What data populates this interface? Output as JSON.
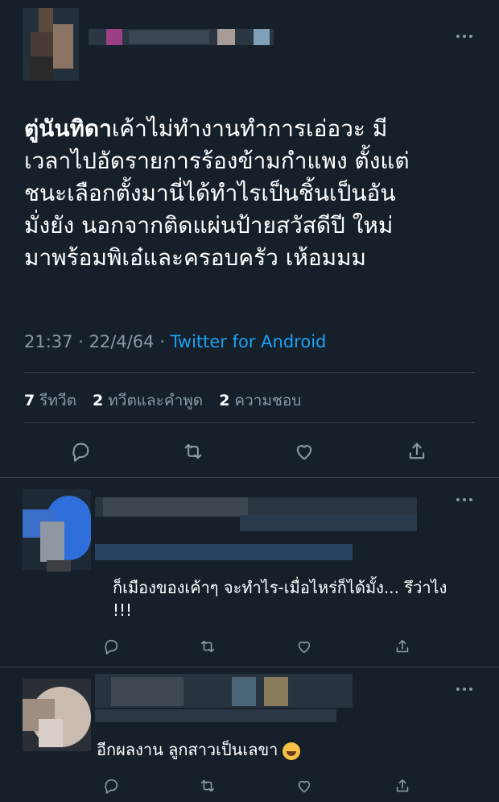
{
  "tweet": {
    "mention": "ตู่นันทิดา",
    "lines": [
      "เค้าไม่ทำงานทำการเอ่อวะ มี",
      "เวลาไปอัดรายการร้องข้ามกำแพง ตั้งแต่",
      "ชนะเลือกตั้งมานี่ได้ทำไรเป็นชิ้นเป็นอัน",
      "มั่งยัง นอกจากติดแผ่นป้ายสวัสดีปี ใหม่",
      "มาพร้อมพิเอ๋และครอบครัว เห้อมมม"
    ],
    "time": "21:37",
    "separator": " · ",
    "date": "22/4/64",
    "separator2": " · ",
    "source": "Twitter for Android",
    "stats": {
      "retweets": "7",
      "retweets_label": "รีทวีต",
      "quotes": "2",
      "quotes_label": "ทวีตและคำพูด",
      "likes": "2",
      "likes_label": "ความชอบ"
    }
  },
  "replies": [
    {
      "line1": "ก็เมืองของเค้าๆ จะทำไร-เมื่อไหร่ก็ได้มั้ง... รึว่าไง",
      "line2": "!!!"
    },
    {
      "line1": "อีกผลงาน ลูกสาวเป็นเลขา",
      "emoji": "rolling-on-floor-laughing-emoji"
    }
  ],
  "icons": {
    "reply": "reply-icon",
    "retweet": "retweet-icon",
    "like": "heart-icon",
    "share": "share-icon",
    "more": "more-icon"
  },
  "colors": {
    "background": "#15202b",
    "text": "#ffffff",
    "muted": "#8899a6",
    "link": "#1da1f2",
    "divider": "#38444d"
  }
}
